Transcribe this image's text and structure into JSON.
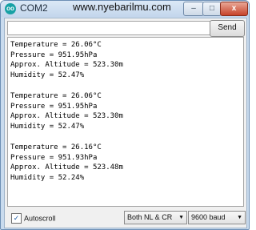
{
  "window": {
    "app_icon": "oo",
    "title": "COM2",
    "url_text": "www.nyebarilmu.com",
    "controls": {
      "minimize": "–",
      "maximize": "□",
      "close": "x"
    }
  },
  "input": {
    "value": "",
    "placeholder": ""
  },
  "send_button": {
    "label": "Send"
  },
  "output": {
    "blocks": [
      {
        "temperature": "Temperature = 26.06°C",
        "pressure": "Pressure = 951.95hPa",
        "altitude": "Approx. Altitude = 523.30m",
        "humidity": "Humidity = 52.47%"
      },
      {
        "temperature": "Temperature = 26.06°C",
        "pressure": "Pressure = 951.95hPa",
        "altitude": "Approx. Altitude = 523.30m",
        "humidity": "Humidity = 52.47%"
      },
      {
        "temperature": "Temperature = 26.16°C",
        "pressure": "Pressure = 951.93hPa",
        "altitude": "Approx. Altitude = 523.48m",
        "humidity": "Humidity = 52.24%"
      }
    ]
  },
  "footer": {
    "autoscroll": {
      "label": "Autoscroll",
      "checked": true,
      "check_glyph": "✓"
    },
    "line_ending": {
      "selected": "Both NL & CR"
    },
    "baud_rate": {
      "selected": "9600 baud"
    },
    "dropdown_glyph": "▼"
  }
}
